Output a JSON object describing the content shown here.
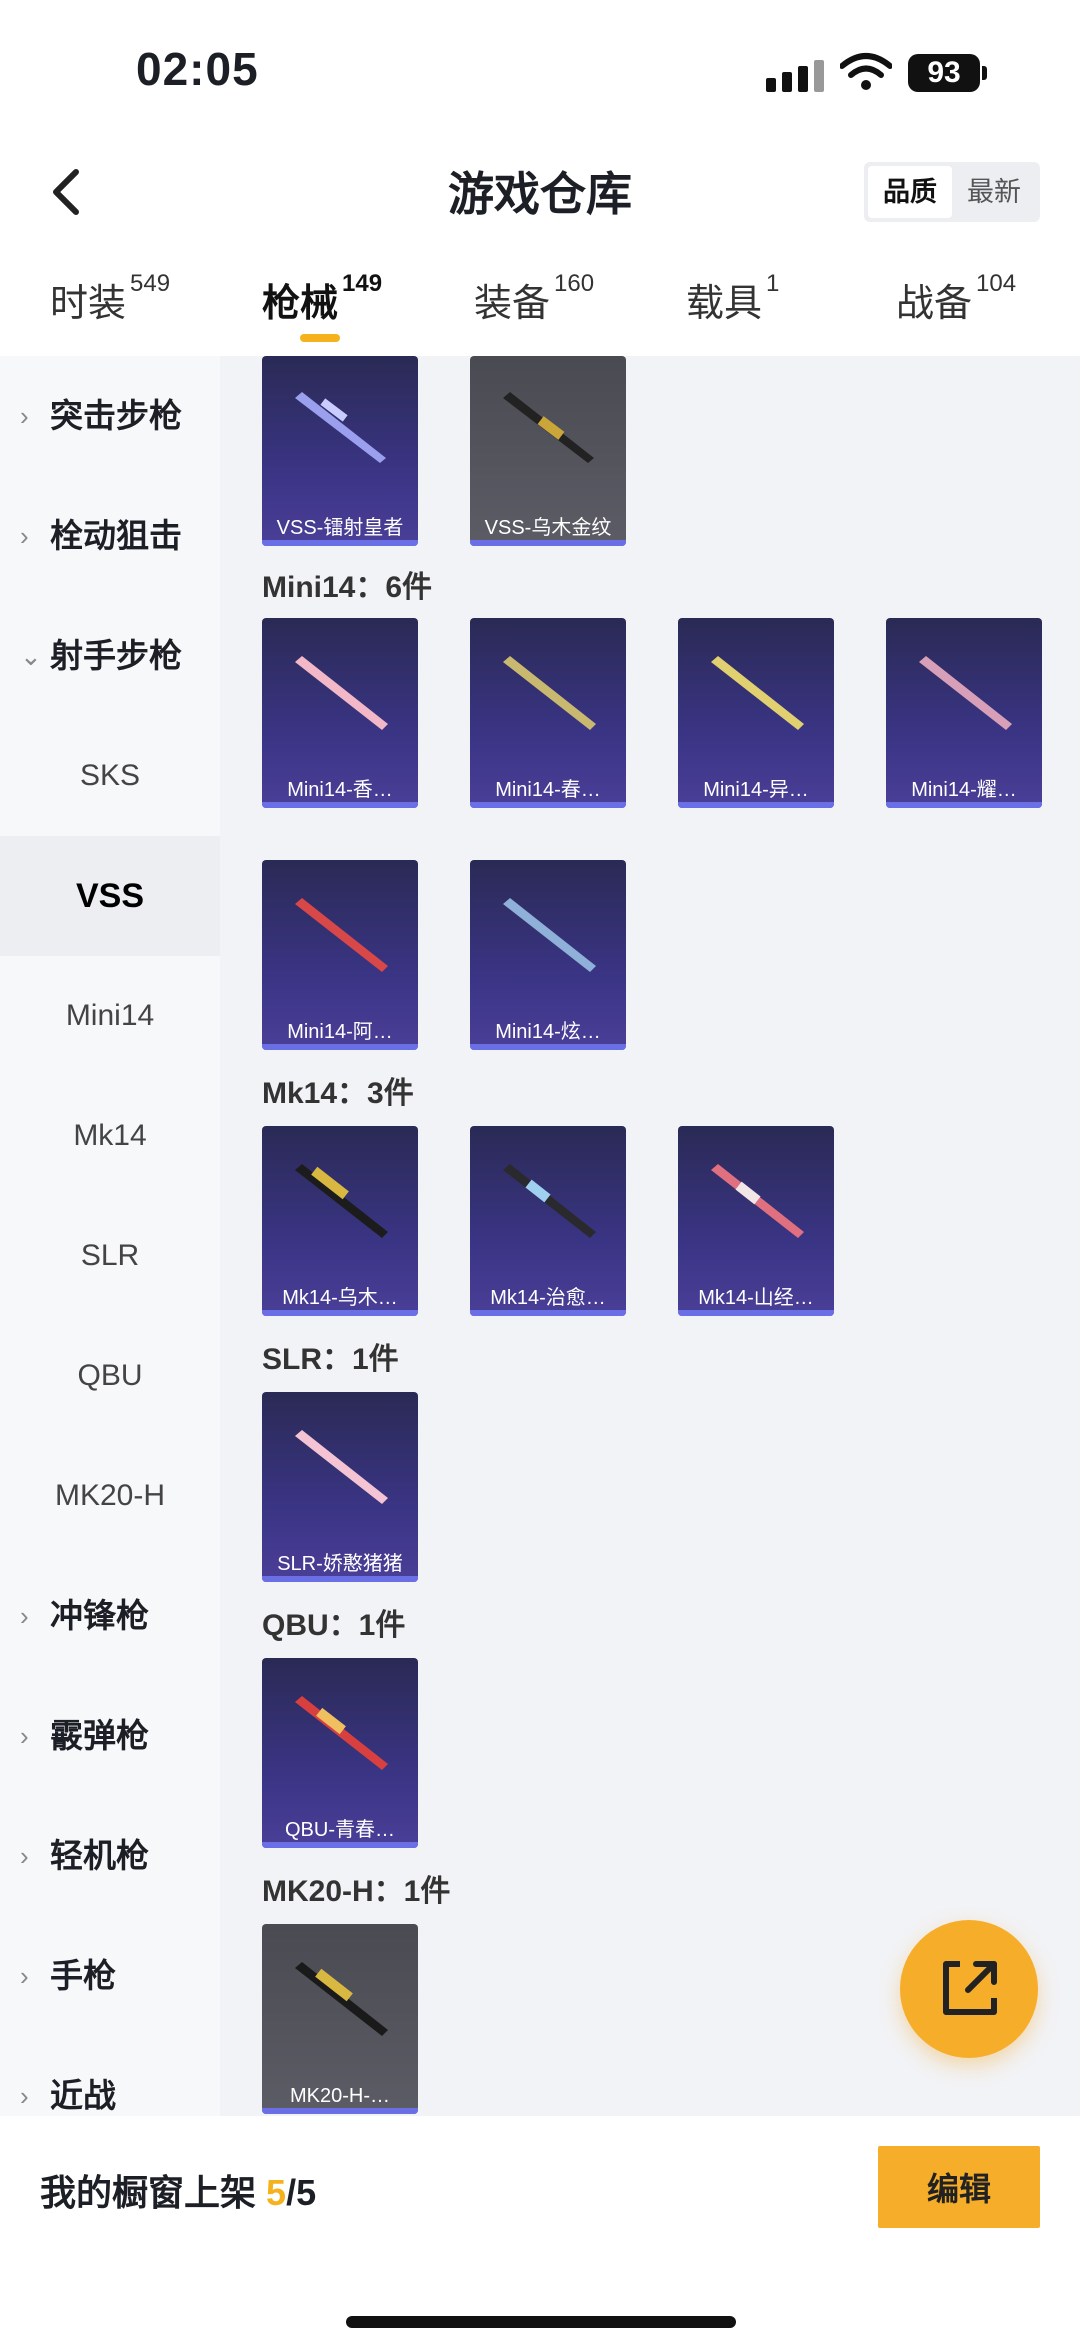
{
  "status": {
    "time": "02:05",
    "battery": "93"
  },
  "header": {
    "title": "游戏仓库",
    "sort_quality": "品质",
    "sort_newest": "最新"
  },
  "tabs": [
    {
      "label": "时装",
      "count": "549"
    },
    {
      "label": "枪械",
      "count": "149"
    },
    {
      "label": "装备",
      "count": "160"
    },
    {
      "label": "载具",
      "count": "1"
    },
    {
      "label": "战备",
      "count": "104"
    }
  ],
  "sidebar": {
    "assault": "突击步枪",
    "bolt": "栓动狙击",
    "marksman": "射手步枪",
    "sks": "SKS",
    "vss": "VSS",
    "mini14": "Mini14",
    "mk14": "Mk14",
    "slr": "SLR",
    "qbu": "QBU",
    "mk20h": "MK20-H",
    "smg": "冲锋枪",
    "shotgun": "霰弹枪",
    "lmg": "轻机枪",
    "pistol": "手枪",
    "melee": "近战"
  },
  "groups": {
    "mini14": "Mini14：6件",
    "mk14": "Mk14：3件",
    "slr": "SLR：1件",
    "qbu": "QBU：1件",
    "mk20h": "MK20-H：1件"
  },
  "cards": {
    "vss1": "VSS-镭射皇者",
    "vss2": "VSS-乌木金纹",
    "mini1": "Mini14-香…",
    "mini2": "Mini14-春…",
    "mini3": "Mini14-异…",
    "mini4": "Mini14-耀…",
    "mini5": "Mini14-阿…",
    "mini6": "Mini14-炫…",
    "mk1": "Mk14-乌木…",
    "mk2": "Mk14-治愈…",
    "mk3": "Mk14-山经…",
    "slr1": "SLR-娇憨猪猪",
    "qbu1": "QBU-青春…",
    "mk20": "MK20-H-…"
  },
  "footer": {
    "label": "我的橱窗上架",
    "used": "5",
    "total": "/5",
    "edit": "编辑"
  },
  "colors": {
    "accent": "#f6ad2a",
    "card_purple": "#3a3484",
    "card_gray": "#55555e"
  }
}
